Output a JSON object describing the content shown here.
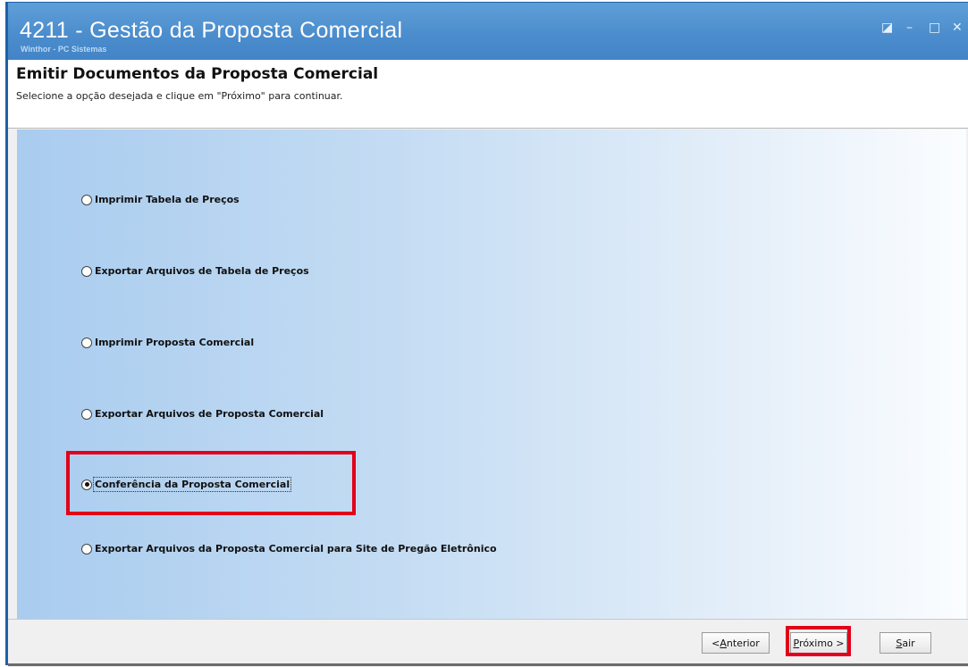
{
  "window": {
    "title": "4211 - Gestão da Proposta Comercial",
    "subtitle": "Winthor - PC Sistemas",
    "controls": {
      "restore": "◪",
      "minimize": "–",
      "maximize": "□",
      "close": "✕"
    }
  },
  "header": {
    "title": "Emitir Documentos da Proposta Comercial",
    "description": "Selecione a opção desejada e clique em \"Próximo\" para continuar."
  },
  "options": [
    {
      "label": "Imprimir Tabela de Preços",
      "checked": false
    },
    {
      "label": "Exportar Arquivos de Tabela de Preços",
      "checked": false
    },
    {
      "label": "Imprimir Proposta Comercial",
      "checked": false
    },
    {
      "label": "Exportar Arquivos de Proposta Comercial",
      "checked": false
    },
    {
      "label": "Conferência da Proposta Comercial",
      "checked": true
    },
    {
      "label": "Exportar Arquivos da Proposta Comercial para Site de Pregão Eletrônico",
      "checked": false
    }
  ],
  "buttons": {
    "back": {
      "label": "< Anterior",
      "prefix": "< ",
      "accel": "A",
      "rest": "nterior"
    },
    "next": {
      "label": "Próximo >",
      "accel": "P",
      "rest": "róximo >"
    },
    "exit": {
      "label": "Sair",
      "accel": "S",
      "rest": "air"
    }
  },
  "colors": {
    "highlight": "#e2001a",
    "titlebar": "#4a8ccc"
  }
}
